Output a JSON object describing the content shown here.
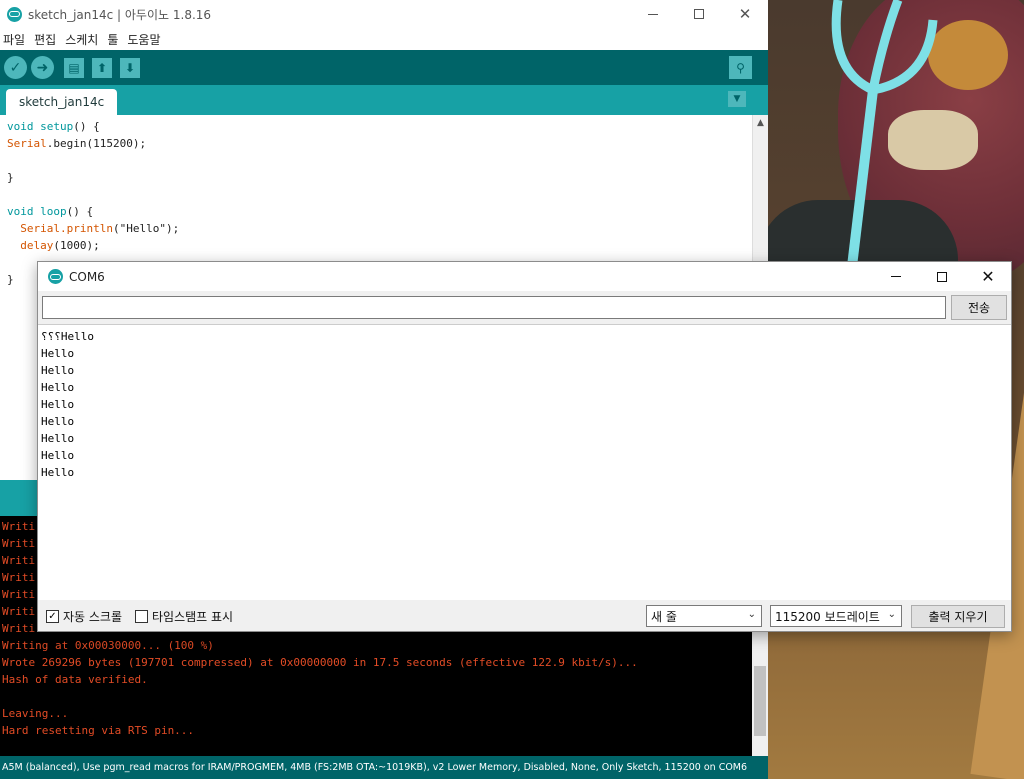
{
  "ide": {
    "title": "sketch_jan14c | 아두이노 1.8.16",
    "menu": [
      "파일",
      "편집",
      "스케치",
      "툴",
      "도움말"
    ],
    "tab_name": "sketch_jan14c",
    "code": {
      "line1_kw": "void",
      "line1_fn": "setup",
      "line1_rest": "() {",
      "line2_obj": "Serial",
      "line2_rest": ".begin(115200);",
      "line4": "}",
      "line6_kw": "void",
      "line6_fn": "loop",
      "line6_rest": "() {",
      "line7_obj": "Serial",
      "line7_fn": ".println",
      "line7_rest": "(\"Hello\");",
      "line8_fn": "delay",
      "line8_rest": "(1000);",
      "line10": "}"
    },
    "console_lines": [
      "Writi",
      "Writi",
      "Writi",
      "Writi",
      "Writi",
      "Writi",
      "Writi",
      "Writing at 0x00030000... (100 %)",
      "Wrote 269296 bytes (197701 compressed) at 0x00000000 in 17.5 seconds (effective 122.9 kbit/s)...",
      "Hash of data verified.",
      "",
      "Leaving...",
      "Hard resetting via RTS pin..."
    ],
    "status": "A5M (balanced), Use pgm_read macros for IRAM/PROGMEM, 4MB (FS:2MB OTA:~1019KB), v2 Lower Memory, Disabled, None, Only Sketch, 115200 on COM6"
  },
  "serial_monitor": {
    "title": "COM6",
    "input_value": "",
    "send_label": "전송",
    "output_lines": [
      "⸮⸮⸮Hello",
      "Hello",
      "Hello",
      "Hello",
      "Hello",
      "Hello",
      "Hello",
      "Hello",
      "Hello"
    ],
    "autoscroll_label": "자동 스크롤",
    "autoscroll_checked": true,
    "timestamp_label": "타임스탬프 표시",
    "timestamp_checked": false,
    "line_ending": "새 줄",
    "baud_rate": "115200 보드레이트",
    "clear_label": "출력 지우기"
  },
  "colors": {
    "toolbar": "#006468",
    "tabbar": "#17a1a5",
    "button": "#4db7bb",
    "console_text": "#e34c26"
  }
}
